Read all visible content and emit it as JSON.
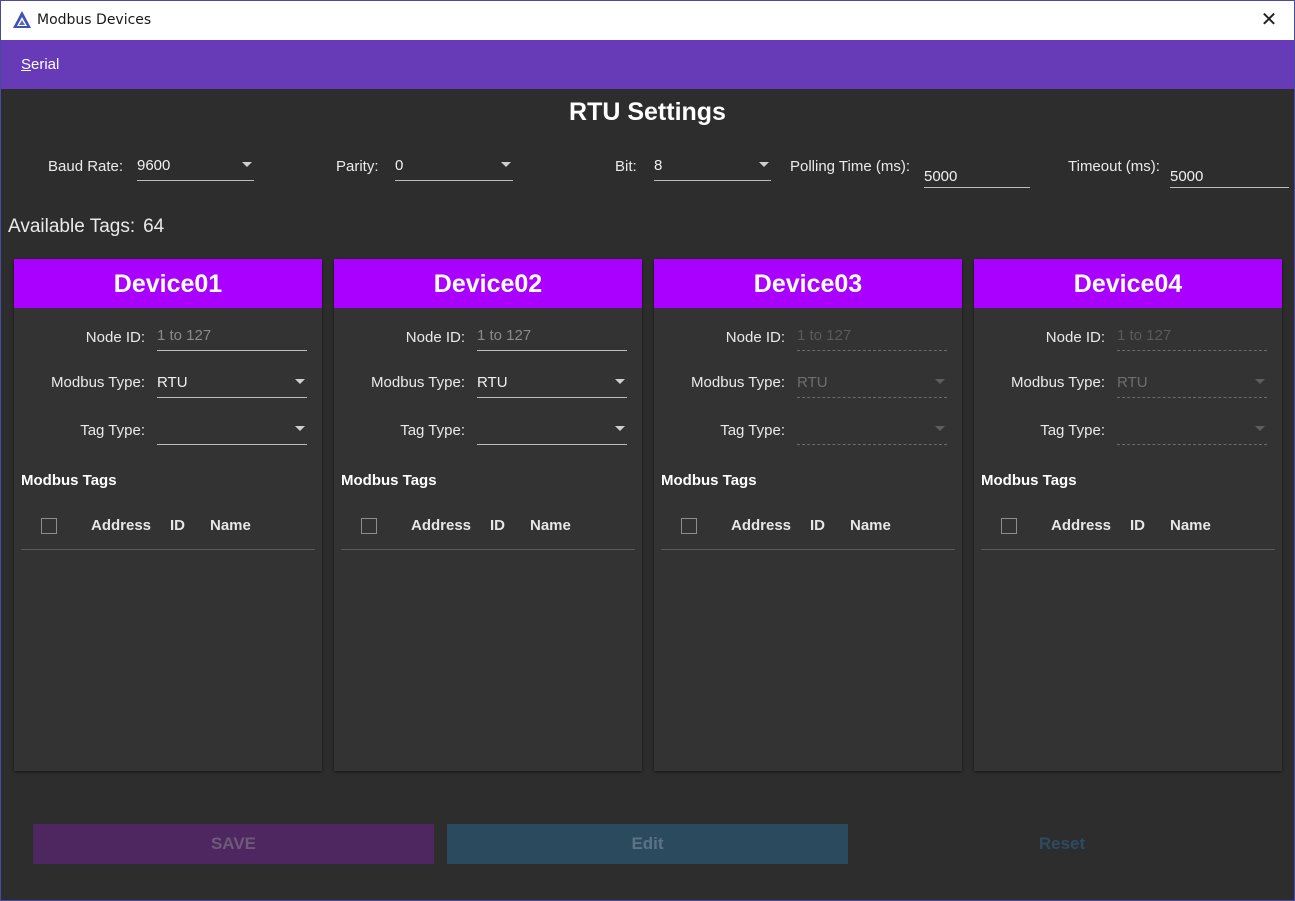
{
  "window": {
    "title": "Modbus Devices",
    "close_glyph": "✕"
  },
  "menu": {
    "items": [
      {
        "label_underlined": "S",
        "label_rest": "erial"
      }
    ]
  },
  "rtu": {
    "title": "RTU Settings",
    "baud_rate": {
      "label": "Baud Rate:",
      "value": "9600"
    },
    "parity": {
      "label": "Parity:",
      "value": "0"
    },
    "bit": {
      "label": "Bit:",
      "value": "8"
    },
    "polling": {
      "label": "Polling Time (ms):",
      "value": "5000"
    },
    "timeout": {
      "label": "Timeout (ms):",
      "value": "5000"
    }
  },
  "available_tags": {
    "label": "Available Tags:",
    "value": "64"
  },
  "devices": [
    {
      "name": "Device01",
      "node_id_label": "Node ID:",
      "node_id_placeholder": "1 to 127",
      "modbus_type_label": "Modbus Type:",
      "modbus_type": "RTU",
      "tag_type_label": "Tag Type:",
      "tag_type": "",
      "tags_title": "Modbus Tags",
      "columns": [
        "Address",
        "ID",
        "Name"
      ],
      "enabled": true
    },
    {
      "name": "Device02",
      "node_id_label": "Node ID:",
      "node_id_placeholder": "1 to 127",
      "modbus_type_label": "Modbus Type:",
      "modbus_type": "RTU",
      "tag_type_label": "Tag Type:",
      "tag_type": "",
      "tags_title": "Modbus Tags",
      "columns": [
        "Address",
        "ID",
        "Name"
      ],
      "enabled": true
    },
    {
      "name": "Device03",
      "node_id_label": "Node ID:",
      "node_id_placeholder": "1 to 127",
      "modbus_type_label": "Modbus Type:",
      "modbus_type": "RTU",
      "tag_type_label": "Tag Type:",
      "tag_type": "",
      "tags_title": "Modbus Tags",
      "columns": [
        "Address",
        "ID",
        "Name"
      ],
      "enabled": false
    },
    {
      "name": "Device04",
      "node_id_label": "Node ID:",
      "node_id_placeholder": "1 to 127",
      "modbus_type_label": "Modbus Type:",
      "modbus_type": "RTU",
      "tag_type_label": "Tag Type:",
      "tag_type": "",
      "tags_title": "Modbus Tags",
      "columns": [
        "Address",
        "ID",
        "Name"
      ],
      "enabled": false
    }
  ],
  "buttons": {
    "save": "SAVE",
    "edit": "Edit",
    "reset": "Reset"
  },
  "colors": {
    "menubar": "#673ab7",
    "card_header": "#aa00ff",
    "background": "#2d2d2d",
    "save_disabled": "#4e2761",
    "edit_disabled": "#2c4a5e"
  }
}
